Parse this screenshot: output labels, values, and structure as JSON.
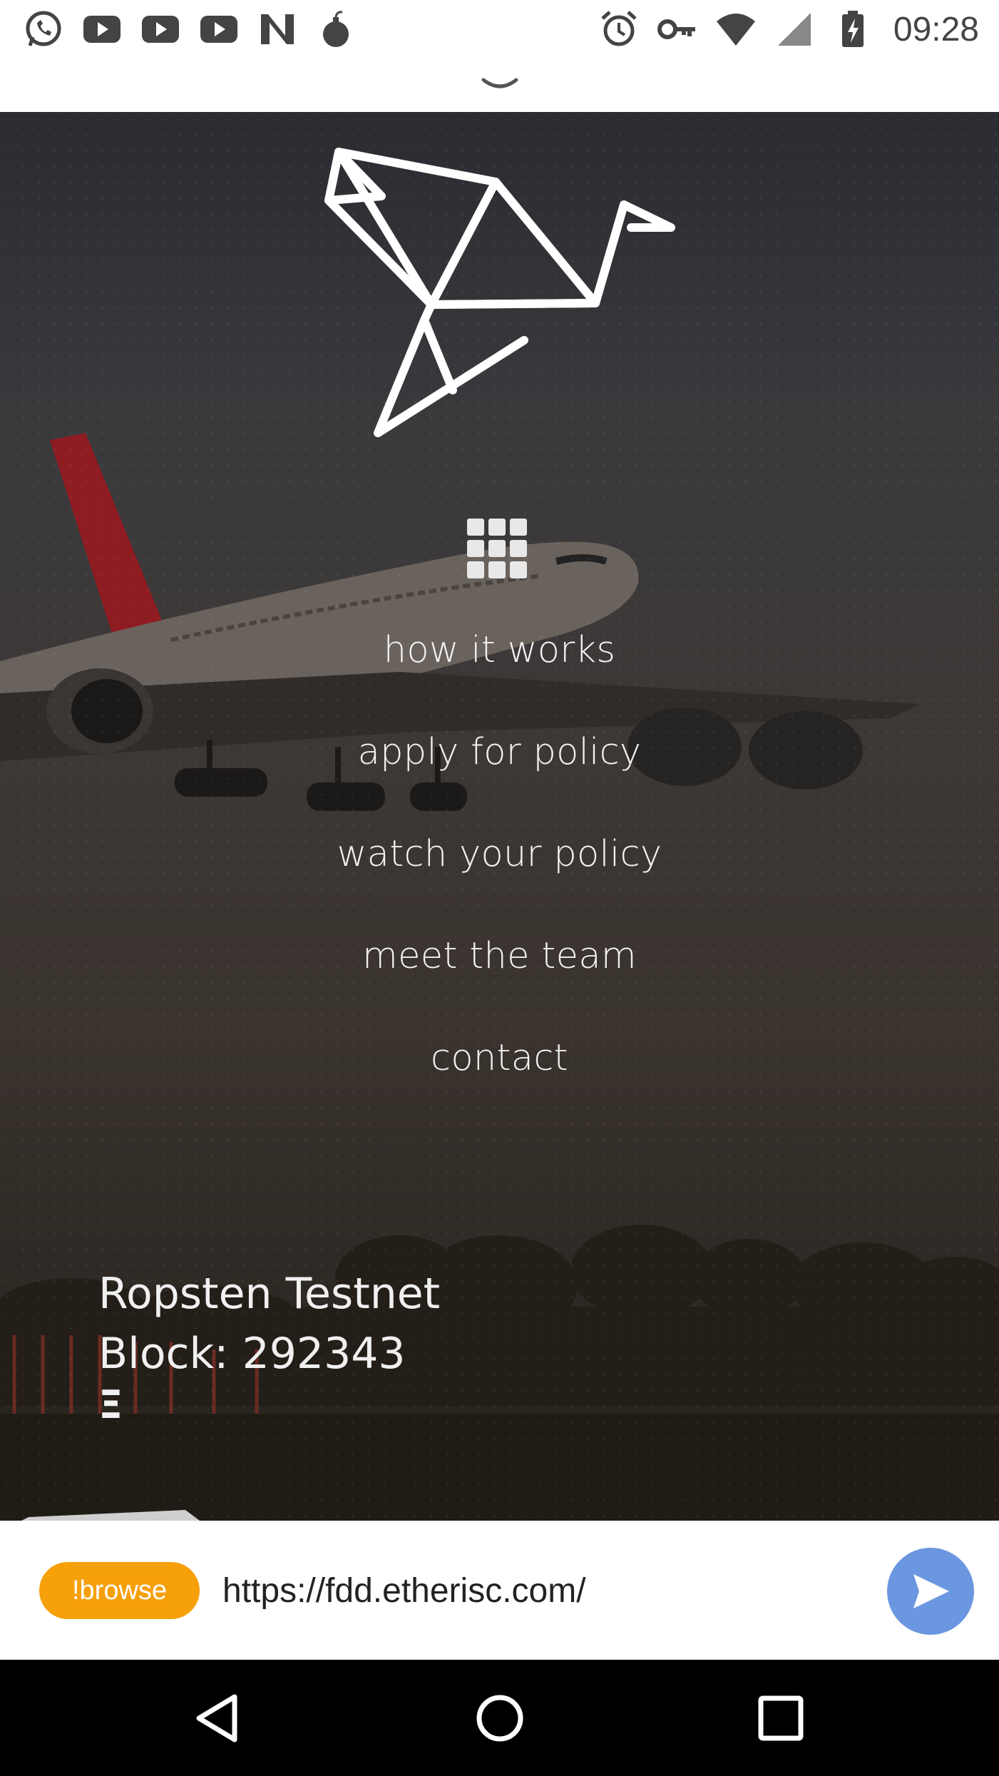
{
  "status_bar": {
    "notification_icons": [
      "whatsapp-icon",
      "youtube-icon",
      "youtube-icon",
      "youtube-icon",
      "n-app-icon",
      "bomb-icon"
    ],
    "system_icons": [
      "alarm-icon",
      "key-icon",
      "wifi-icon",
      "cell-signal-icon",
      "battery-charging-icon"
    ],
    "time": "09:28"
  },
  "hero": {
    "menu_items": [
      "how it works",
      "apply for policy",
      "watch your policy",
      "meet the team",
      "contact"
    ],
    "network_name": "Ropsten Testnet",
    "block_label": "Block: 292343",
    "currency_symbol": "Ξ"
  },
  "browser_bar": {
    "browse_label": "!browse",
    "url": "https://fdd.etherisc.com/"
  },
  "colors": {
    "browse_button": "#f6a00a",
    "send_button": "#6b96e0"
  }
}
